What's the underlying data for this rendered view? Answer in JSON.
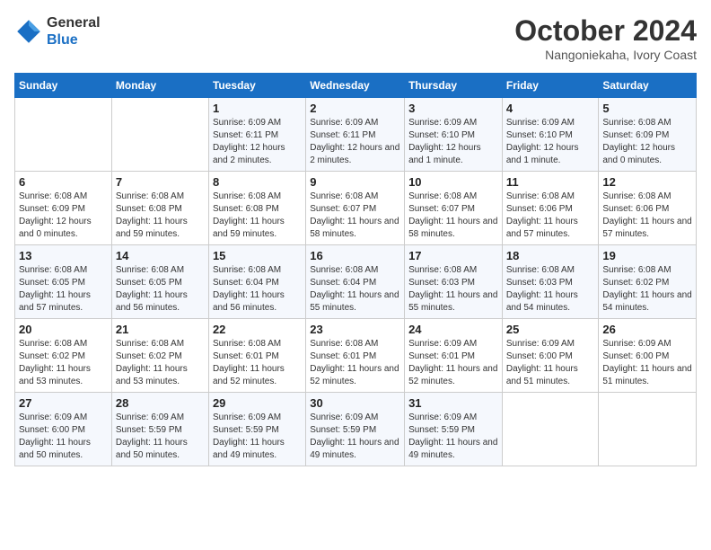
{
  "logo": {
    "general": "General",
    "blue": "Blue"
  },
  "title": "October 2024",
  "subtitle": "Nangoniekaha, Ivory Coast",
  "days_of_week": [
    "Sunday",
    "Monday",
    "Tuesday",
    "Wednesday",
    "Thursday",
    "Friday",
    "Saturday"
  ],
  "weeks": [
    [
      {
        "day": "",
        "detail": ""
      },
      {
        "day": "",
        "detail": ""
      },
      {
        "day": "1",
        "detail": "Sunrise: 6:09 AM\nSunset: 6:11 PM\nDaylight: 12 hours and 2 minutes."
      },
      {
        "day": "2",
        "detail": "Sunrise: 6:09 AM\nSunset: 6:11 PM\nDaylight: 12 hours and 2 minutes."
      },
      {
        "day": "3",
        "detail": "Sunrise: 6:09 AM\nSunset: 6:10 PM\nDaylight: 12 hours and 1 minute."
      },
      {
        "day": "4",
        "detail": "Sunrise: 6:09 AM\nSunset: 6:10 PM\nDaylight: 12 hours and 1 minute."
      },
      {
        "day": "5",
        "detail": "Sunrise: 6:08 AM\nSunset: 6:09 PM\nDaylight: 12 hours and 0 minutes."
      }
    ],
    [
      {
        "day": "6",
        "detail": "Sunrise: 6:08 AM\nSunset: 6:09 PM\nDaylight: 12 hours and 0 minutes."
      },
      {
        "day": "7",
        "detail": "Sunrise: 6:08 AM\nSunset: 6:08 PM\nDaylight: 11 hours and 59 minutes."
      },
      {
        "day": "8",
        "detail": "Sunrise: 6:08 AM\nSunset: 6:08 PM\nDaylight: 11 hours and 59 minutes."
      },
      {
        "day": "9",
        "detail": "Sunrise: 6:08 AM\nSunset: 6:07 PM\nDaylight: 11 hours and 58 minutes."
      },
      {
        "day": "10",
        "detail": "Sunrise: 6:08 AM\nSunset: 6:07 PM\nDaylight: 11 hours and 58 minutes."
      },
      {
        "day": "11",
        "detail": "Sunrise: 6:08 AM\nSunset: 6:06 PM\nDaylight: 11 hours and 57 minutes."
      },
      {
        "day": "12",
        "detail": "Sunrise: 6:08 AM\nSunset: 6:06 PM\nDaylight: 11 hours and 57 minutes."
      }
    ],
    [
      {
        "day": "13",
        "detail": "Sunrise: 6:08 AM\nSunset: 6:05 PM\nDaylight: 11 hours and 57 minutes."
      },
      {
        "day": "14",
        "detail": "Sunrise: 6:08 AM\nSunset: 6:05 PM\nDaylight: 11 hours and 56 minutes."
      },
      {
        "day": "15",
        "detail": "Sunrise: 6:08 AM\nSunset: 6:04 PM\nDaylight: 11 hours and 56 minutes."
      },
      {
        "day": "16",
        "detail": "Sunrise: 6:08 AM\nSunset: 6:04 PM\nDaylight: 11 hours and 55 minutes."
      },
      {
        "day": "17",
        "detail": "Sunrise: 6:08 AM\nSunset: 6:03 PM\nDaylight: 11 hours and 55 minutes."
      },
      {
        "day": "18",
        "detail": "Sunrise: 6:08 AM\nSunset: 6:03 PM\nDaylight: 11 hours and 54 minutes."
      },
      {
        "day": "19",
        "detail": "Sunrise: 6:08 AM\nSunset: 6:02 PM\nDaylight: 11 hours and 54 minutes."
      }
    ],
    [
      {
        "day": "20",
        "detail": "Sunrise: 6:08 AM\nSunset: 6:02 PM\nDaylight: 11 hours and 53 minutes."
      },
      {
        "day": "21",
        "detail": "Sunrise: 6:08 AM\nSunset: 6:02 PM\nDaylight: 11 hours and 53 minutes."
      },
      {
        "day": "22",
        "detail": "Sunrise: 6:08 AM\nSunset: 6:01 PM\nDaylight: 11 hours and 52 minutes."
      },
      {
        "day": "23",
        "detail": "Sunrise: 6:08 AM\nSunset: 6:01 PM\nDaylight: 11 hours and 52 minutes."
      },
      {
        "day": "24",
        "detail": "Sunrise: 6:09 AM\nSunset: 6:01 PM\nDaylight: 11 hours and 52 minutes."
      },
      {
        "day": "25",
        "detail": "Sunrise: 6:09 AM\nSunset: 6:00 PM\nDaylight: 11 hours and 51 minutes."
      },
      {
        "day": "26",
        "detail": "Sunrise: 6:09 AM\nSunset: 6:00 PM\nDaylight: 11 hours and 51 minutes."
      }
    ],
    [
      {
        "day": "27",
        "detail": "Sunrise: 6:09 AM\nSunset: 6:00 PM\nDaylight: 11 hours and 50 minutes."
      },
      {
        "day": "28",
        "detail": "Sunrise: 6:09 AM\nSunset: 5:59 PM\nDaylight: 11 hours and 50 minutes."
      },
      {
        "day": "29",
        "detail": "Sunrise: 6:09 AM\nSunset: 5:59 PM\nDaylight: 11 hours and 49 minutes."
      },
      {
        "day": "30",
        "detail": "Sunrise: 6:09 AM\nSunset: 5:59 PM\nDaylight: 11 hours and 49 minutes."
      },
      {
        "day": "31",
        "detail": "Sunrise: 6:09 AM\nSunset: 5:59 PM\nDaylight: 11 hours and 49 minutes."
      },
      {
        "day": "",
        "detail": ""
      },
      {
        "day": "",
        "detail": ""
      }
    ]
  ]
}
